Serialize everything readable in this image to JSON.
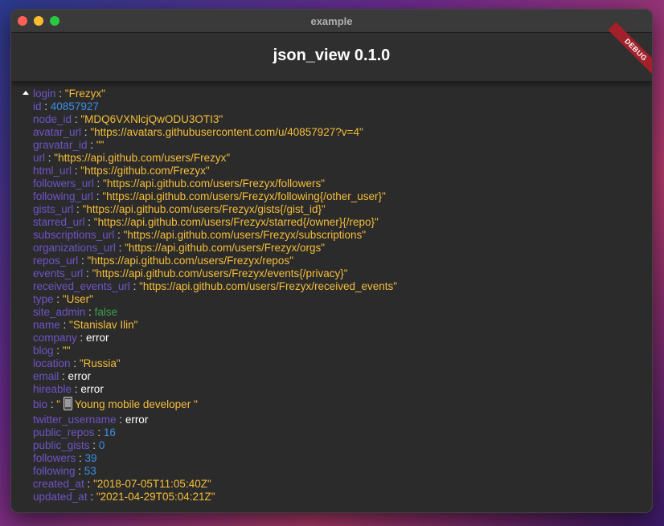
{
  "window": {
    "title": "example"
  },
  "appbar": {
    "title": "json_view 0.1.0",
    "debug_label": "DEBUG"
  },
  "colon": ":",
  "rows": [
    {
      "key": "login",
      "value": "\"Frezyx\"",
      "type": "string"
    },
    {
      "key": "id",
      "value": "40857927",
      "type": "number"
    },
    {
      "key": "node_id",
      "value": "\"MDQ6VXNlcjQwODU3OTI3\"",
      "type": "string"
    },
    {
      "key": "avatar_url",
      "value": "\"https://avatars.githubusercontent.com/u/40857927?v=4\"",
      "type": "string"
    },
    {
      "key": "gravatar_id",
      "value": "\"\"",
      "type": "string"
    },
    {
      "key": "url",
      "value": "\"https://api.github.com/users/Frezyx\"",
      "type": "string"
    },
    {
      "key": "html_url",
      "value": "\"https://github.com/Frezyx\"",
      "type": "string"
    },
    {
      "key": "followers_url",
      "value": "\"https://api.github.com/users/Frezyx/followers\"",
      "type": "string"
    },
    {
      "key": "following_url",
      "value": "\"https://api.github.com/users/Frezyx/following{/other_user}\"",
      "type": "string"
    },
    {
      "key": "gists_url",
      "value": "\"https://api.github.com/users/Frezyx/gists{/gist_id}\"",
      "type": "string"
    },
    {
      "key": "starred_url",
      "value": "\"https://api.github.com/users/Frezyx/starred{/owner}{/repo}\"",
      "type": "string"
    },
    {
      "key": "subscriptions_url",
      "value": "\"https://api.github.com/users/Frezyx/subscriptions\"",
      "type": "string"
    },
    {
      "key": "organizations_url",
      "value": "\"https://api.github.com/users/Frezyx/orgs\"",
      "type": "string"
    },
    {
      "key": "repos_url",
      "value": "\"https://api.github.com/users/Frezyx/repos\"",
      "type": "string"
    },
    {
      "key": "events_url",
      "value": "\"https://api.github.com/users/Frezyx/events{/privacy}\"",
      "type": "string"
    },
    {
      "key": "received_events_url",
      "value": "\"https://api.github.com/users/Frezyx/received_events\"",
      "type": "string"
    },
    {
      "key": "type",
      "value": "\"User\"",
      "type": "string"
    },
    {
      "key": "site_admin",
      "value": "false",
      "type": "bool"
    },
    {
      "key": "name",
      "value": "\"Stanislav Ilin\"",
      "type": "string"
    },
    {
      "key": "company",
      "value": "error",
      "type": "null"
    },
    {
      "key": "blog",
      "value": "\"\"",
      "type": "string"
    },
    {
      "key": "location",
      "value": "\"Russia\"",
      "type": "string"
    },
    {
      "key": "email",
      "value": "error",
      "type": "null"
    },
    {
      "key": "hireable",
      "value": "error",
      "type": "null"
    },
    {
      "key": "bio",
      "value": "\" ",
      "value_after": "Young mobile developer \"",
      "icon": "mobile-phone-icon",
      "type": "string"
    },
    {
      "key": "twitter_username",
      "value": "error",
      "type": "null"
    },
    {
      "key": "public_repos",
      "value": "16",
      "type": "number"
    },
    {
      "key": "public_gists",
      "value": "0",
      "type": "number"
    },
    {
      "key": "followers",
      "value": "39",
      "type": "number"
    },
    {
      "key": "following",
      "value": "53",
      "type": "number"
    },
    {
      "key": "created_at",
      "value": "\"2018-07-05T11:05:40Z\"",
      "type": "string"
    },
    {
      "key": "updated_at",
      "value": "\"2021-04-29T05:04:21Z\"",
      "type": "string"
    }
  ],
  "colors": {
    "key": "#6e55c8",
    "string": "#f6be3a",
    "number": "#3d8ee6",
    "bool": "#3e9c4a",
    "null": "#ffffff"
  }
}
